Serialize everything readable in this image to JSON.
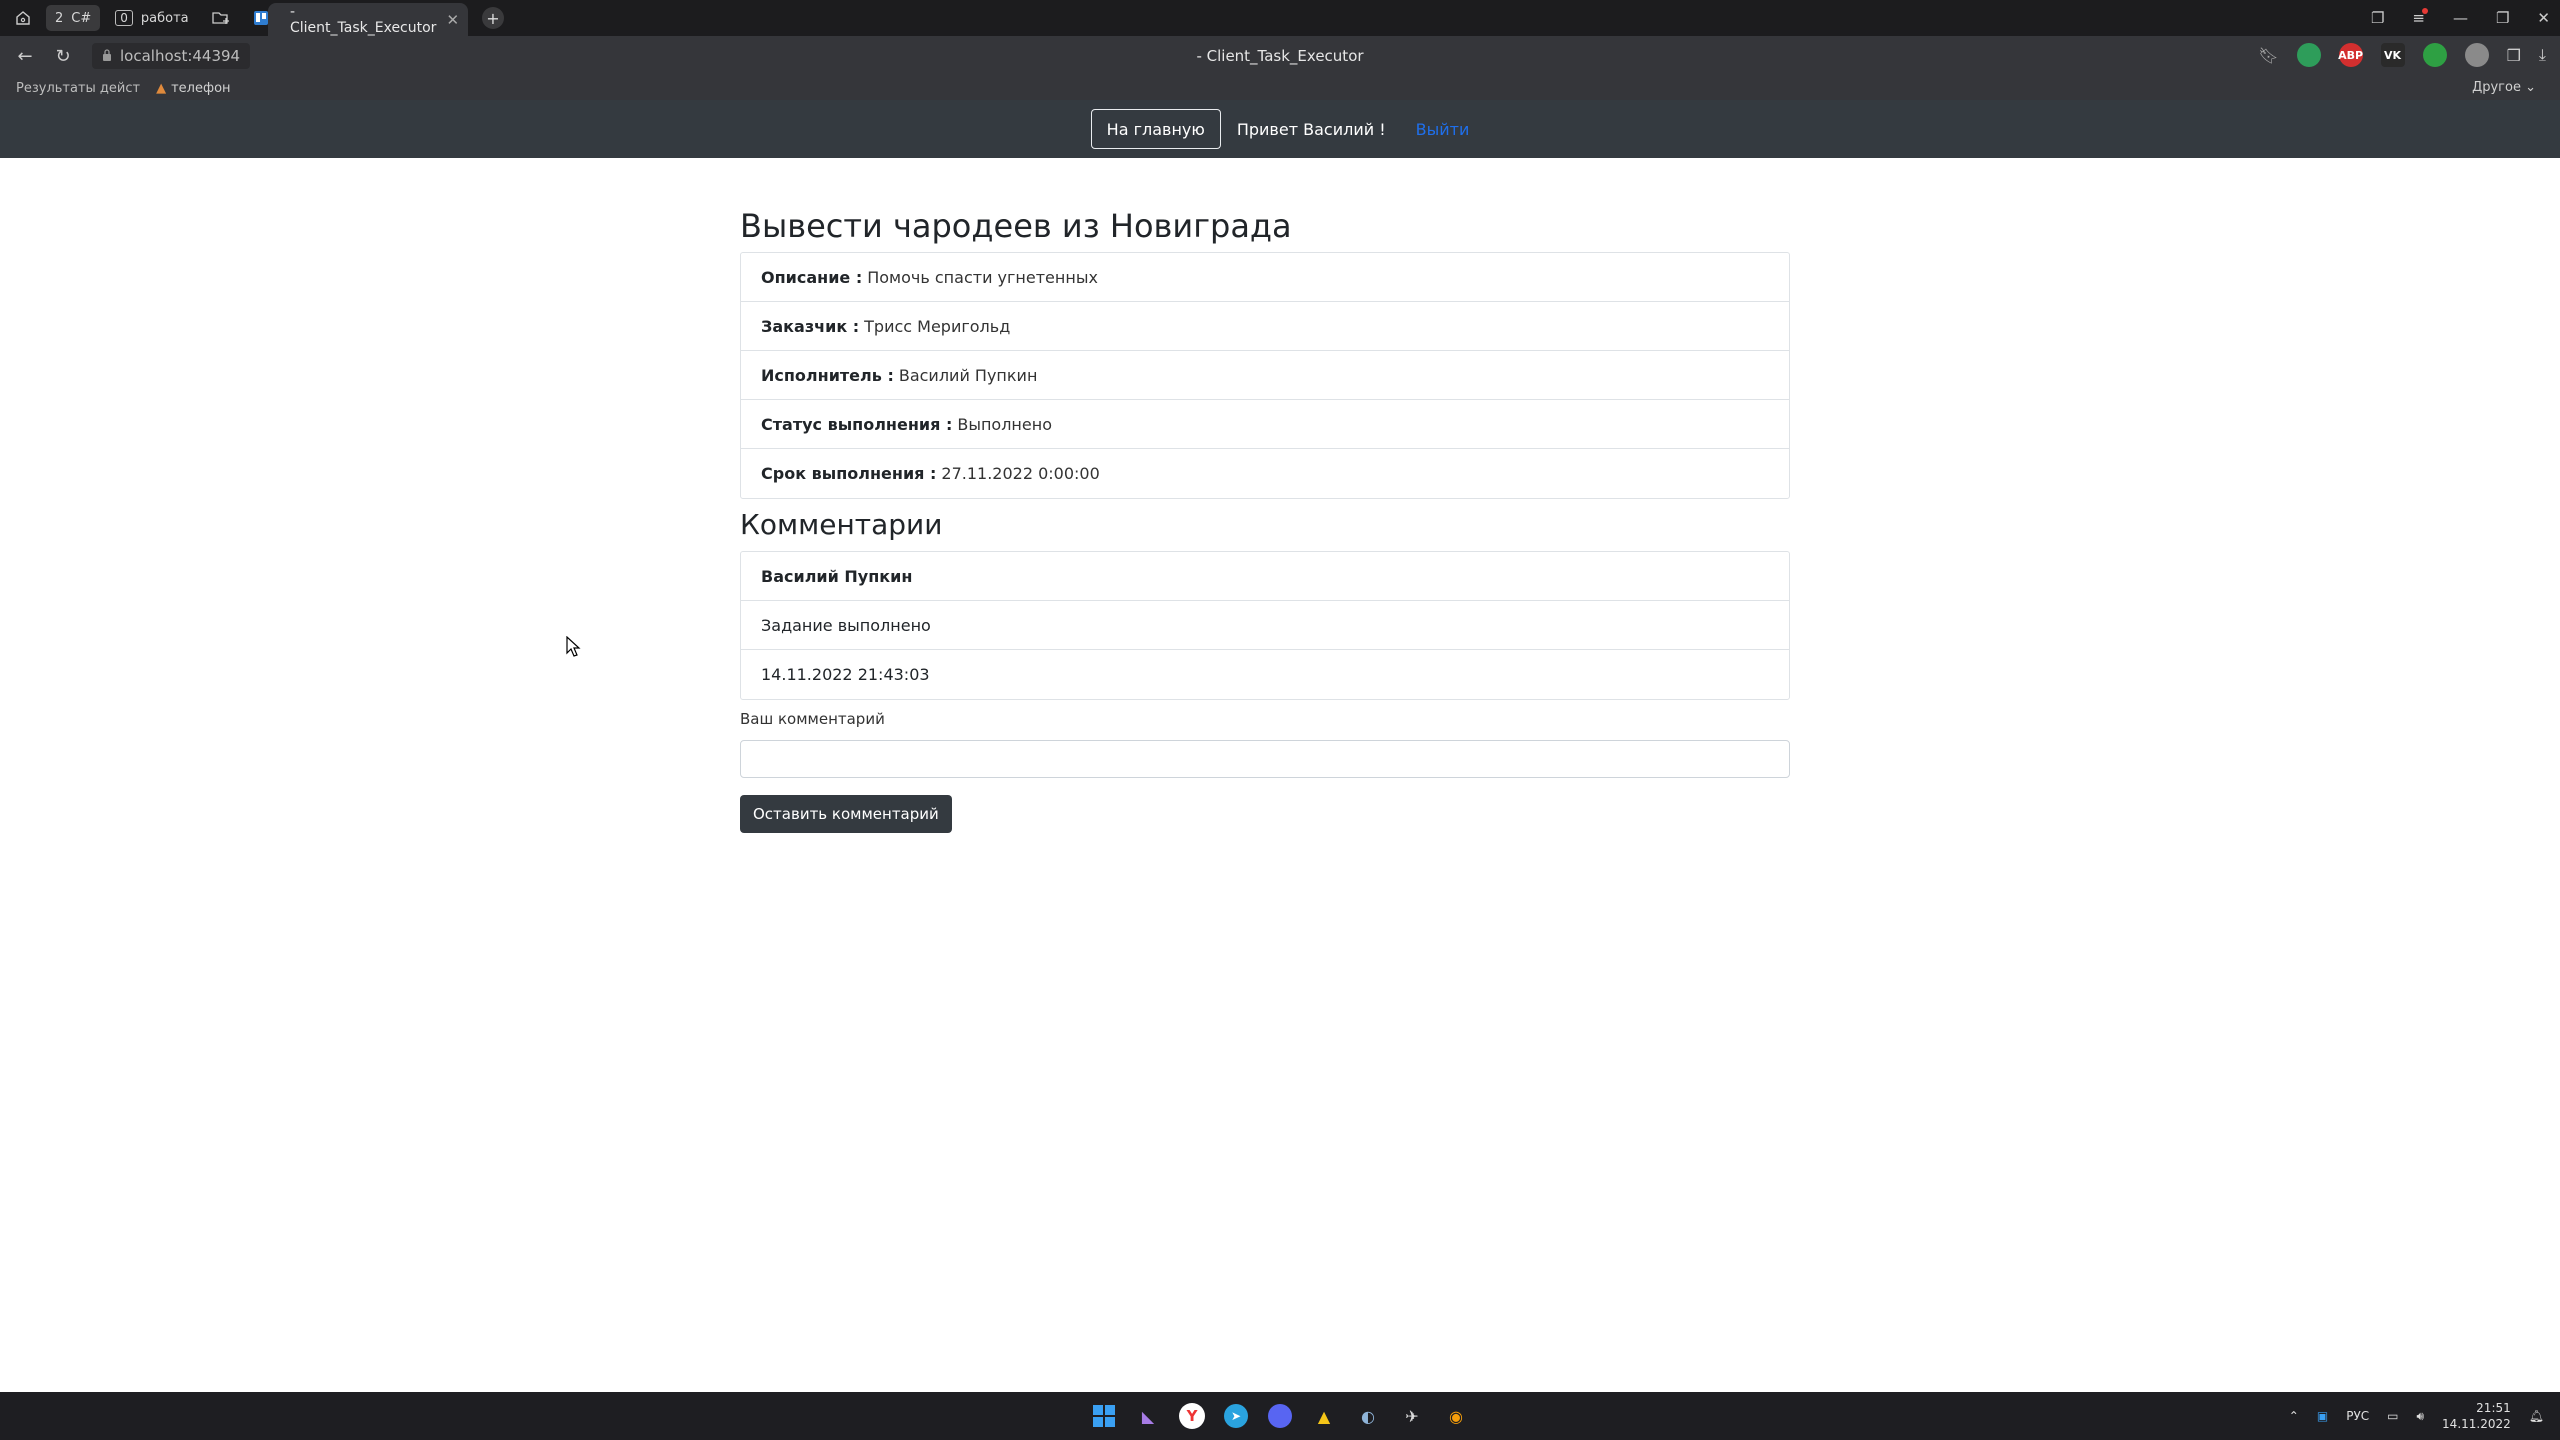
{
  "browser": {
    "tab_groups": [
      {
        "count": "2",
        "label": "C#"
      },
      {
        "count": "0",
        "label": "работа"
      }
    ],
    "active_tab_title": "- Client_Task_Executor",
    "url": "localhost:44394",
    "document_title": "- Client_Task_Executor",
    "bookmarks": [
      "Результаты дейст",
      "телефон"
    ],
    "bookmarks_other": "Другое",
    "extensions": [
      {
        "name": "translate-icon",
        "label": "",
        "color": "#2e9d5a"
      },
      {
        "name": "adblock-icon",
        "label": "ABP",
        "color": "#d32f2f"
      },
      {
        "name": "vk-icon",
        "label": "VK",
        "color": "#2a2a2a"
      },
      {
        "name": "shield-icon",
        "label": "",
        "color": "#2ea043"
      }
    ]
  },
  "site_nav": {
    "home_label": "На главную",
    "greeting": "Привет Василий !",
    "logout_label": "Выйти"
  },
  "task": {
    "title": "Вывести чародеев из Новиграда",
    "fields": [
      {
        "label": "Описание :",
        "value": "Помочь спасти угнетенных"
      },
      {
        "label": "Заказчик :",
        "value": "Трисс Меригольд"
      },
      {
        "label": "Исполнитель :",
        "value": "Василий Пупкин"
      },
      {
        "label": "Статус выполнения :",
        "value": "Выполнено"
      },
      {
        "label": "Срок выполнения :",
        "value": "27.11.2022 0:00:00"
      }
    ]
  },
  "comments": {
    "title": "Комментарии",
    "items": [
      {
        "author": "Василий Пупкин",
        "text": "Задание выполнено",
        "date": "14.11.2022 21:43:03"
      }
    ],
    "input_label": "Ваш комментарий",
    "input_value": "",
    "submit_label": "Оставить комментарий"
  },
  "taskbar": {
    "language": "РУС",
    "time": "21:51",
    "date": "14.11.2022"
  },
  "colors": {
    "navbar": "#343a40",
    "link": "#1f6feb",
    "browser_dark": "#35363a"
  }
}
